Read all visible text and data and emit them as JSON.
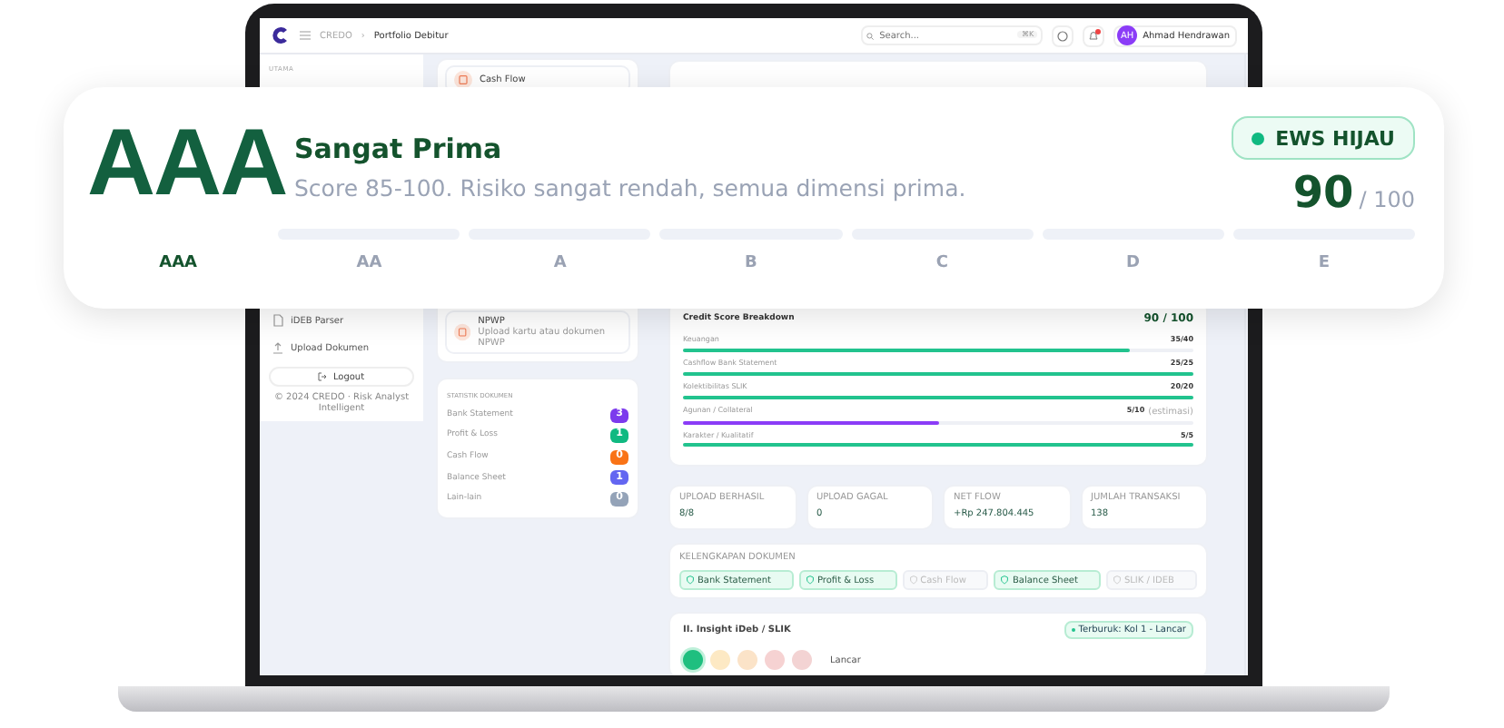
{
  "topbar": {
    "breadcrumb": [
      "CREDO",
      "Portfolio Debitur"
    ],
    "separator": "›",
    "search": {
      "placeholder": "Search...",
      "shortcut": "⌘K"
    },
    "notification": true,
    "user": {
      "initials": "AH",
      "name": "Ahmad Hendrawan"
    }
  },
  "sidebar": {
    "section": "UTAMA",
    "items": [
      {
        "label": "iDEB Parser",
        "kind": "file"
      },
      {
        "label": "Upload Dokumen",
        "kind": "upload"
      }
    ],
    "logout": "Logout",
    "copyright": "© 2024 CREDO · Risk Analyst Intelligent"
  },
  "documents": [
    {
      "title": "Cash Flow"
    },
    {
      "title": "NPWP",
      "subtitle": "Upload kartu atau dokumen NPWP"
    }
  ],
  "document_stats": {
    "title": "STATISTIK DOKUMEN",
    "rows": [
      {
        "label": "Bank Statement",
        "count": "3",
        "color": "#7c3aed"
      },
      {
        "label": "Profit & Loss",
        "count": "1",
        "color": "#10b981"
      },
      {
        "label": "Cash Flow",
        "count": "0",
        "color": "#f97316"
      },
      {
        "label": "Balance Sheet",
        "count": "1",
        "color": "#6366f1"
      },
      {
        "label": "Lain-lain",
        "count": "0",
        "color": "#94a3b8"
      }
    ]
  },
  "breakdown": {
    "title": "Credit Score Breakdown",
    "score": "90 / 100",
    "rows": [
      {
        "label": "Keuangan",
        "value": "35/40",
        "level": 0.875,
        "color": "#22c38e"
      },
      {
        "label": "Cashflow Bank Statement",
        "value": "25/25",
        "level": 1,
        "color": "#22c38e"
      },
      {
        "label": "Kolektibilitas SLIK",
        "value": "20/20",
        "level": 1,
        "color": "#22c38e"
      },
      {
        "label": "Agunan / Collateral",
        "value": "5/10",
        "note": "(estimasi)",
        "level": 0.5,
        "color": "#8b3cf7"
      },
      {
        "label": "Karakter / Kualitatif",
        "value": "5/5",
        "level": 1,
        "color": "#22c38e"
      }
    ]
  },
  "stats": [
    {
      "label": "UPLOAD BERHASIL",
      "value": "8/8"
    },
    {
      "label": "UPLOAD GAGAL",
      "value": "0"
    },
    {
      "label": "NET FLOW",
      "value": "+Rp 247.804.445"
    },
    {
      "label": "JUMLAH TRANSAKSI",
      "value": "138"
    }
  ],
  "completeness": {
    "title": "KELENGKAPAN DOKUMEN",
    "items": [
      {
        "label": "Bank Statement",
        "checked": true
      },
      {
        "label": "Profit & Loss",
        "checked": true
      },
      {
        "label": "Cash Flow",
        "checked": false
      },
      {
        "label": "Balance Sheet",
        "checked": true
      },
      {
        "label": "SLIK / IDEB",
        "checked": false
      }
    ]
  },
  "insight": {
    "title": "II. Insight iDeb / SLIK",
    "badge": "Terburuk: Kol 1 - Lancar",
    "levels": [
      {
        "color": "#1fbf7f",
        "selected": true
      },
      {
        "color": "#fde9c4",
        "selected": false
      },
      {
        "color": "#fbe3c8",
        "selected": false
      },
      {
        "color": "#f6d2d2",
        "selected": false
      },
      {
        "color": "#f3d3d3",
        "selected": false
      }
    ],
    "level_label": "Lancar"
  },
  "rating_card": {
    "grade": "AAA",
    "title": "Sangat Prima",
    "description": "Score 85-100. Risiko sangat rendah, semua dimensi prima.",
    "ews_badge": "EWS HIJAU",
    "score": "90",
    "max": "/ 100",
    "scale": [
      {
        "label": "AAA",
        "selected": true
      },
      {
        "label": "AA",
        "selected": false
      },
      {
        "label": "A",
        "selected": false
      },
      {
        "label": "B",
        "selected": false
      },
      {
        "label": "C",
        "selected": false
      },
      {
        "label": "D",
        "selected": false
      },
      {
        "label": "E",
        "selected": false
      }
    ]
  }
}
